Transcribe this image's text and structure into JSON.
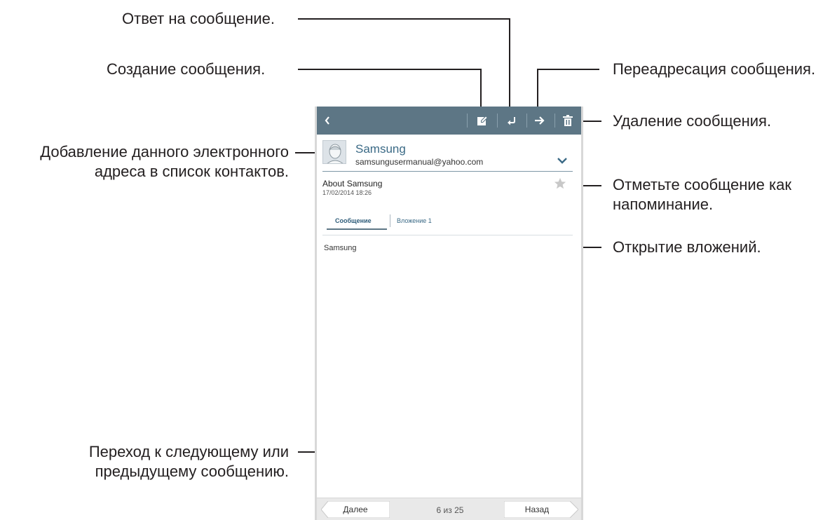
{
  "callouts": {
    "reply": "Ответ на сообщение.",
    "compose": "Создание сообщения.",
    "forward": "Переадресация сообщения.",
    "delete": "Удаление сообщения.",
    "add_contact": [
      "Добавление данного электронного",
      "адреса в список контактов."
    ],
    "mark_reminder": [
      "Отметьте сообщение как",
      "напоминание."
    ],
    "open_attachments": "Открытие вложений.",
    "navigate": [
      "Переход к следующему или",
      "предыдущему сообщению."
    ]
  },
  "actionbar": {
    "icons": [
      "back-icon",
      "compose-icon",
      "reply-icon",
      "forward-icon",
      "delete-icon"
    ],
    "color": "#5d7685"
  },
  "message": {
    "sender_name": "Samsung",
    "sender_email": "samsungusermanual@yahoo.com",
    "subject": "About Samsung",
    "date": "17/02/2014  18:26",
    "tabs": [
      "Сообщение",
      "Вложение 1"
    ],
    "active_tab": "Сообщение",
    "body": "Samsung"
  },
  "bottombar": {
    "next_label": "Далее",
    "prev_label": "Назад",
    "page_indicator": "6 из 25"
  }
}
